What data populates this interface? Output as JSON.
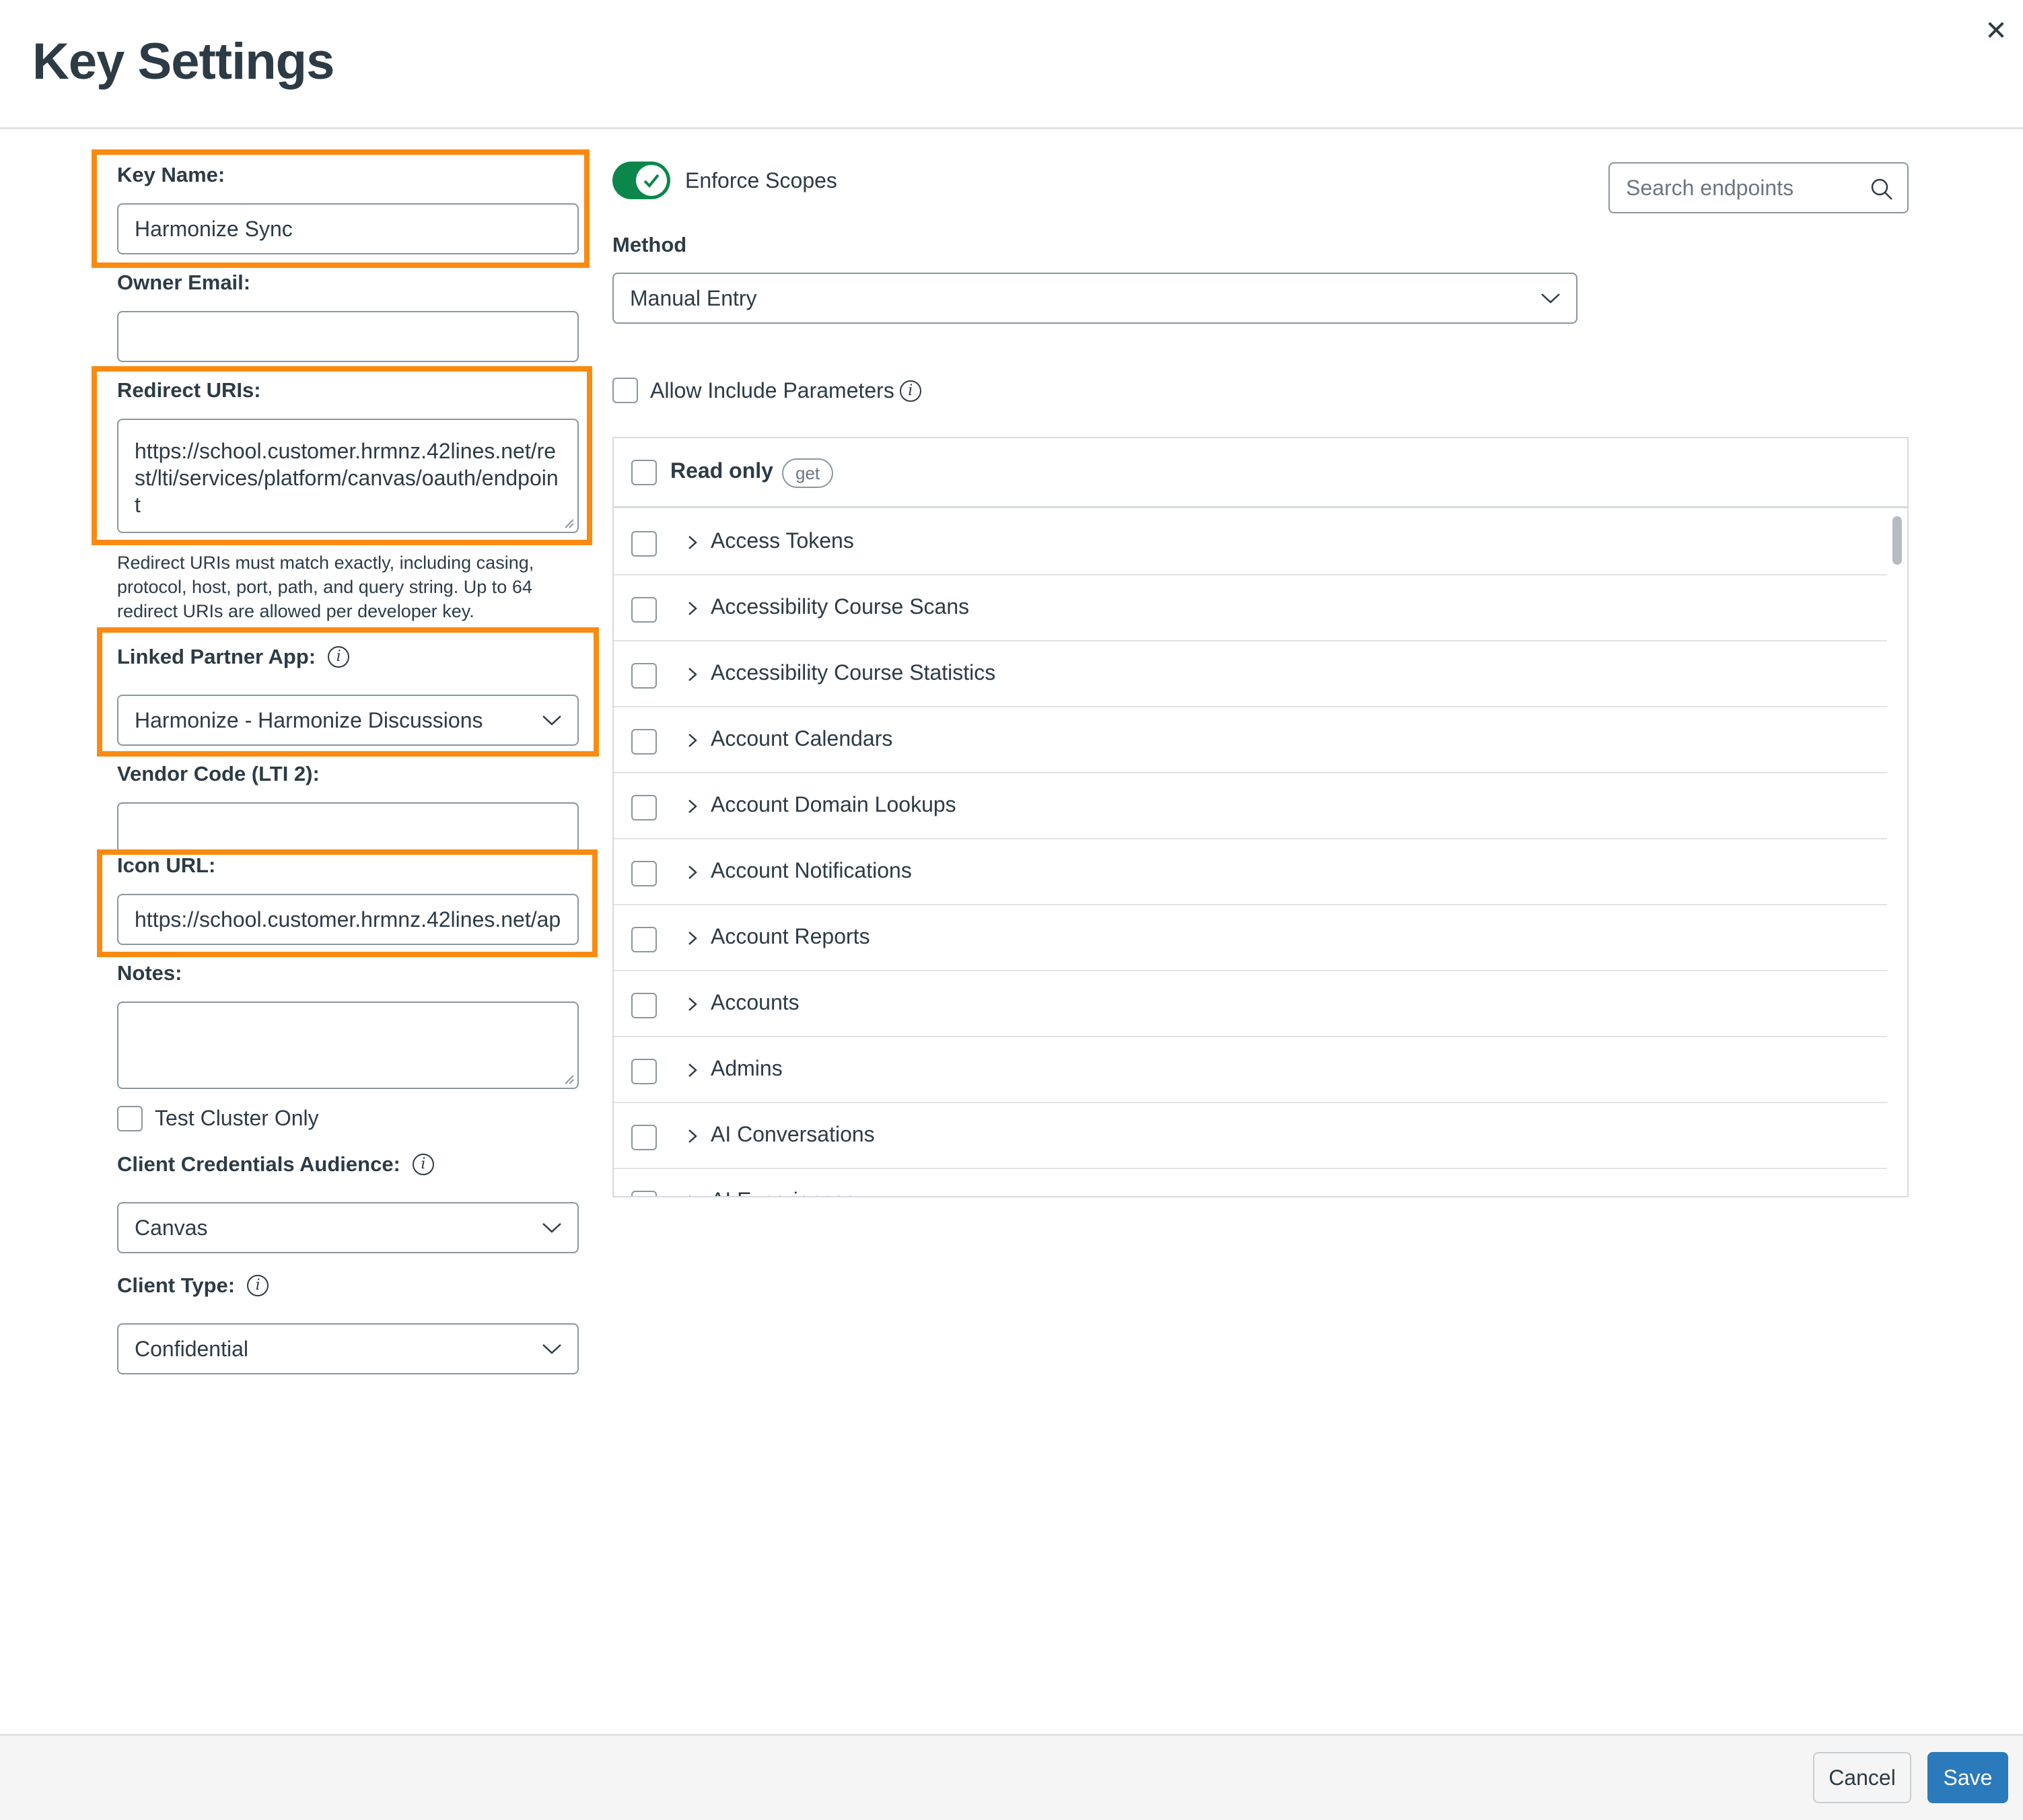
{
  "modal": {
    "title": "Key Settings",
    "close_icon": "close-icon"
  },
  "form": {
    "key_name": {
      "label": "Key Name:",
      "value": "Harmonize Sync"
    },
    "owner_email": {
      "label": "Owner Email:",
      "value": ""
    },
    "redirect_uris": {
      "label": "Redirect URIs:",
      "value": "https://school.customer.hrmnz.42lines.net/rest/lti/services/platform/canvas/oauth/endpoint",
      "help": "Redirect URIs must match exactly, including casing, protocol, host, port, path, and query string. Up to 64 redirect URIs are allowed per developer key."
    },
    "linked_partner_app": {
      "label": "Linked Partner App:",
      "value": "Harmonize - Harmonize Discussions"
    },
    "vendor_code": {
      "label": "Vendor Code (LTI 2):",
      "value": ""
    },
    "icon_url": {
      "label": "Icon URL:",
      "value": "https://school.customer.hrmnz.42lines.net/ap"
    },
    "notes": {
      "label": "Notes:",
      "value": ""
    },
    "test_cluster_only": {
      "label": "Test Cluster Only",
      "checked": false
    },
    "client_credentials_audience": {
      "label": "Client Credentials Audience:",
      "value": "Canvas"
    },
    "client_type": {
      "label": "Client Type:",
      "value": "Confidential"
    }
  },
  "scopes": {
    "enforce_scopes": {
      "label": "Enforce Scopes",
      "on": true
    },
    "method": {
      "label": "Method",
      "value": "Manual Entry"
    },
    "search": {
      "placeholder": "Search endpoints"
    },
    "allow_include_parameters": {
      "label": "Allow Include Parameters",
      "checked": false
    },
    "read_only": {
      "label": "Read only",
      "badge": "get"
    },
    "items": [
      {
        "label": "Access Tokens"
      },
      {
        "label": "Accessibility Course Scans"
      },
      {
        "label": "Accessibility Course Statistics"
      },
      {
        "label": "Account Calendars"
      },
      {
        "label": "Account Domain Lookups"
      },
      {
        "label": "Account Notifications"
      },
      {
        "label": "Account Reports"
      },
      {
        "label": "Accounts"
      },
      {
        "label": "Admins"
      },
      {
        "label": "AI Conversations"
      },
      {
        "label": "AI Experiences"
      }
    ]
  },
  "footer": {
    "cancel_label": "Cancel",
    "save_label": "Save"
  },
  "colors": {
    "highlight": "#fb8a11",
    "toggle_on": "#0b874b",
    "save_button": "#2b7abc",
    "text": "#2d3b45"
  }
}
